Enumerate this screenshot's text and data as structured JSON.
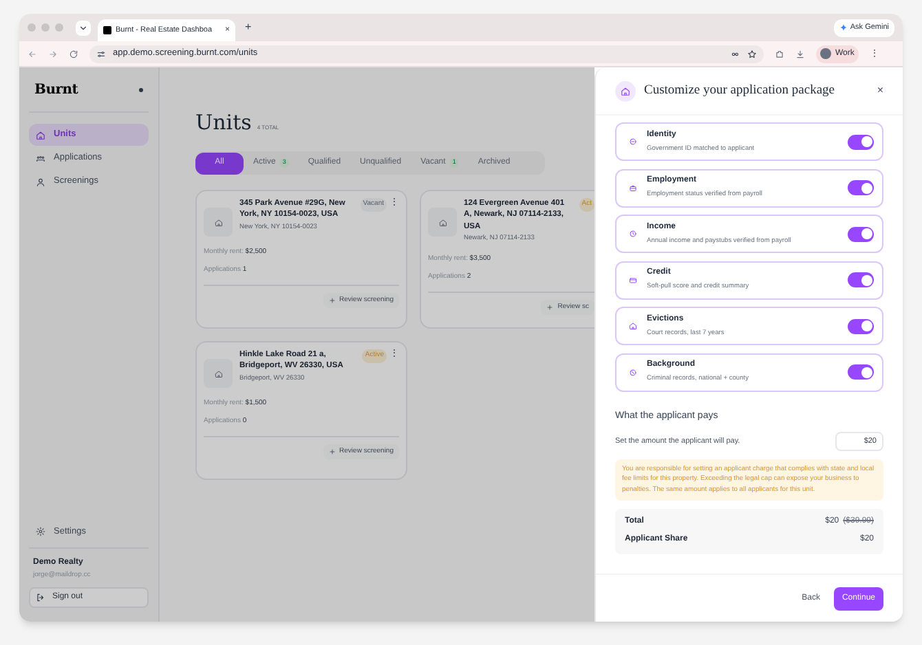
{
  "browser": {
    "tabs": [
      {
        "title": "Burnt - Real Estate Dashboa",
        "close": "×",
        "selected": true
      }
    ],
    "menu": "⋮",
    "new_tab": "+",
    "ask_gemini": "Ask Gemini",
    "url": "app.demo.screening.burnt.com/units",
    "profile": "Work"
  },
  "sidebar": {
    "logo": "Burnt",
    "items": [
      {
        "label": "Units",
        "selected": true
      },
      {
        "label": "Applications",
        "selected": false
      },
      {
        "label": "Screenings",
        "selected": false
      }
    ],
    "settings": "Settings",
    "org": "Demo Realty",
    "email": "jorge@maildrop.cc",
    "sign_out": "Sign out"
  },
  "main": {
    "title": "Units",
    "total": "4 TOTAL",
    "filters": [
      {
        "label": "All",
        "selected": true
      },
      {
        "label": "Active",
        "count": "3",
        "selected": false
      },
      {
        "label": "Qualified",
        "selected": false
      },
      {
        "label": "Unqualified",
        "selected": false
      },
      {
        "label": "Vacant",
        "count": "1",
        "selected": false
      },
      {
        "label": "Archived",
        "selected": false
      }
    ],
    "cards": [
      {
        "address": "345 Park Avenue #29G, New York, NY 10154-0023, USA",
        "city": "New York, NY 10154-0023",
        "status": "Vacant",
        "more": "⋮",
        "rent_label": "Monthly rent:",
        "rent": "$2,500",
        "apps_label": "Applications",
        "apps": "1",
        "action": "Review screening"
      },
      {
        "address": "124 Evergreen Avenue 401 A, Newark, NJ 07114-2133, USA",
        "city": "Newark, NJ 07114-2133",
        "status": "Act",
        "rent_label": "Monthly rent:",
        "rent": "$3,500",
        "apps_label": "Applications",
        "apps": "2",
        "action": "Review sc"
      },
      {
        "address": "Hinkle Lake Road 21 a, Bridgeport, WV 26330, USA",
        "city": "Bridgeport, WV 26330",
        "status": "Active",
        "more": "⋮",
        "rent_label": "Monthly rent:",
        "rent": "$1,500",
        "apps_label": "Applications",
        "apps": "0",
        "action": "Review screening"
      }
    ]
  },
  "modal": {
    "title": "Customize your application package",
    "close": "×",
    "checks": [
      {
        "title": "Identity",
        "description": "Government ID matched to applicant",
        "on": true
      },
      {
        "title": "Employment",
        "description": "Employment status verified from payroll",
        "on": true
      },
      {
        "title": "Income",
        "description": "Annual income and paystubs verified from payroll",
        "on": true
      },
      {
        "title": "Credit",
        "description": "Soft-pull score and credit summary",
        "on": true
      },
      {
        "title": "Evictions",
        "description": "Court records, last 7 years",
        "on": true
      },
      {
        "title": "Background",
        "description": "Criminal records, national + county",
        "on": true
      }
    ],
    "pays_heading": "What the applicant pays",
    "amount_label": "Set the amount the applicant will pay.",
    "amount": "$20",
    "warning": "You are responsible for setting an applicant charge that complies with state and local fee limits for this property. Exceeding the legal cap can expose your business to penalties. The same amount applies to all applicants for this unit.",
    "summary": [
      {
        "label": "Total",
        "value": "$20",
        "original": "($39.99)"
      },
      {
        "label": "Applicant Share",
        "value": "$20"
      }
    ],
    "back": "Back",
    "continue": "Continue"
  }
}
